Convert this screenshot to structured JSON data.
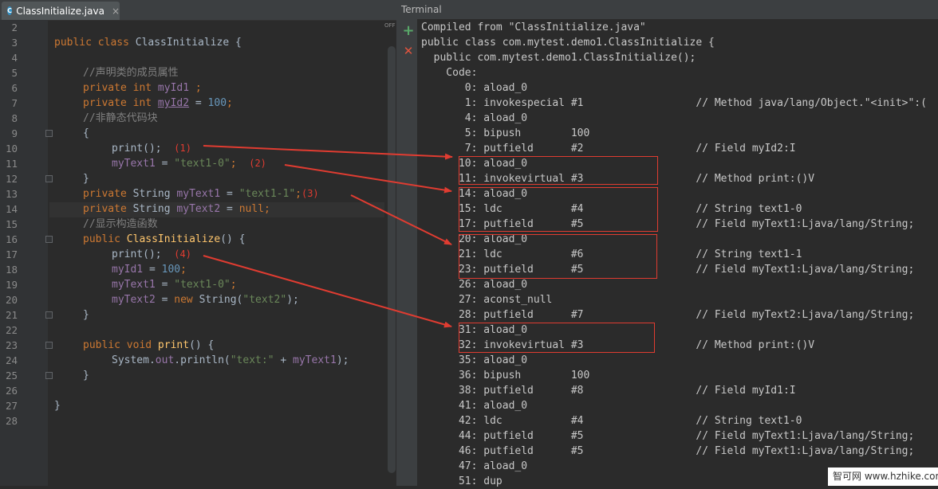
{
  "editor": {
    "tab": {
      "icon": "java-class-icon",
      "icon_letter": "C",
      "label": "ClassInitialize.java",
      "close": "×"
    },
    "off_label": "OFF",
    "line_numbers": [
      "2",
      "3",
      "4",
      "5",
      "6",
      "7",
      "8",
      "9",
      "10",
      "11",
      "12",
      "13",
      "14",
      "15",
      "16",
      "17",
      "18",
      "19",
      "20",
      "21",
      "22",
      "23",
      "24",
      "25",
      "26",
      "27",
      "28"
    ],
    "code": {
      "l3_kw": "public class ",
      "l3_name": "ClassInitialize {",
      "l5": "//声明类的成员属性",
      "l6_kw": "private int ",
      "l6_fld": "myId1",
      "l6_rest": " ;",
      "l7_kw": "private int ",
      "l7_fld": "myId2",
      "l7_eq": " = ",
      "l7_num": "100",
      "l7_end": ";",
      "l8": "//非静态代码块",
      "l9": "{",
      "l10_call": "print();",
      "l10_anno": "(1)",
      "l11_fld": "myText1",
      "l11_eq": " = ",
      "l11_str": "\"text1-0\"",
      "l11_end": ";",
      "l11_anno": "(2)",
      "l12": "}",
      "l13_kw": "private ",
      "l13_type": "String ",
      "l13_fld": "myText1",
      "l13_eq": " = ",
      "l13_str": "\"text1-1\"",
      "l13_end": ";",
      "l13_anno": "(3)",
      "l14_kw": "private ",
      "l14_type": "String ",
      "l14_fld": "myText2",
      "l14_eq": " = ",
      "l14_null": "null",
      "l14_end": ";",
      "l15": "//显示构造函数",
      "l16_kw": "public ",
      "l16_fn": "ClassInitialize",
      "l16_rest": "() {",
      "l17_call": "print();",
      "l17_anno": "(4)",
      "l18_fld": "myId1",
      "l18_eq": " = ",
      "l18_num": "100",
      "l18_end": ";",
      "l19_fld": "myText1",
      "l19_eq": " = ",
      "l19_str": "\"text1-0\"",
      "l19_end": ";",
      "l20_fld": "myText2",
      "l20_eq": " = ",
      "l20_kw": "new ",
      "l20_type": "String(",
      "l20_str": "\"text2\"",
      "l20_end": ");",
      "l21": "}",
      "l23_kw": "public void ",
      "l23_fn": "print",
      "l23_rest": "() {",
      "l24_a": "System.",
      "l24_out": "out",
      "l24_b": ".println(",
      "l24_str": "\"text:\"",
      "l24_c": " + ",
      "l24_fld": "myText1",
      "l24_end": ");",
      "l25": "}",
      "l27": "}"
    }
  },
  "terminal": {
    "title": "Terminal",
    "add_button": "+",
    "close_button": "✕",
    "lines": [
      "Compiled from \"ClassInitialize.java\"",
      "public class com.mytest.demo1.ClassInitialize {",
      "  public com.mytest.demo1.ClassInitialize();",
      "    Code:",
      "       0: aload_0",
      "       1: invokespecial #1                  // Method java/lang/Object.\"<init>\":(",
      "       4: aload_0",
      "       5: bipush        100",
      "       7: putfield      #2                  // Field myId2:I",
      "      10: aload_0",
      "      11: invokevirtual #3                  // Method print:()V",
      "      14: aload_0",
      "      15: ldc           #4                  // String text1-0",
      "      17: putfield      #5                  // Field myText1:Ljava/lang/String;",
      "      20: aload_0",
      "      21: ldc           #6                  // String text1-1",
      "      23: putfield      #5                  // Field myText1:Ljava/lang/String;",
      "      26: aload_0",
      "      27: aconst_null",
      "      28: putfield      #7                  // Field myText2:Ljava/lang/String;",
      "      31: aload_0",
      "      32: invokevirtual #3                  // Method print:()V",
      "      35: aload_0",
      "      36: bipush        100",
      "      38: putfield      #8                  // Field myId1:I",
      "      41: aload_0",
      "      42: ldc           #4                  // String text1-0",
      "      44: putfield      #5                  // Field myText1:Ljava/lang/String;",
      "      46: putfield      #5                  // Field myText1:Ljava/lang/String;",
      "      47: aload_0",
      "      51: dup"
    ]
  },
  "watermark": "智可网 www.hzhike.com",
  "colors": {
    "annotation": "#e03c31",
    "keyword": "#cc7832",
    "field": "#9876aa",
    "string": "#6a8759",
    "number": "#6897bb",
    "comment": "#808080"
  }
}
